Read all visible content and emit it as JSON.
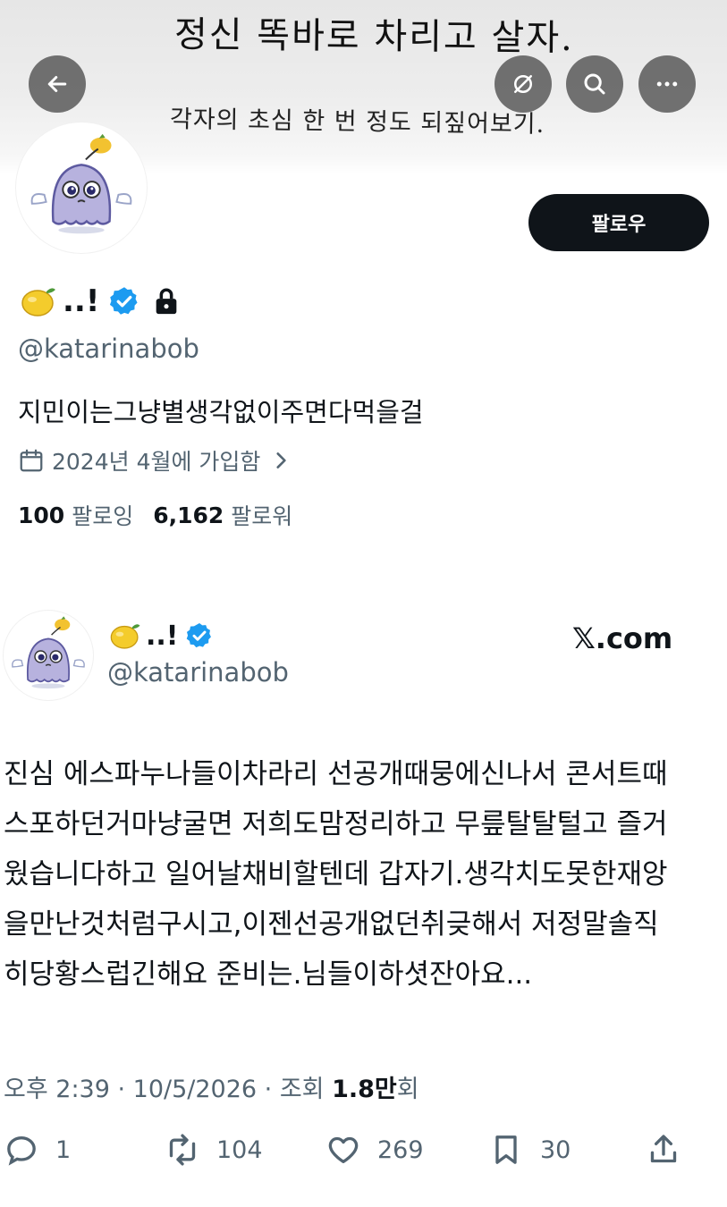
{
  "banner": {
    "line1": "정신 똑바로 차리고 살자.",
    "line2": "각자의 초심 한 번 정도 되짚어보기."
  },
  "header": {
    "back_icon": "arrow-left-icon",
    "grok_icon": "slash-circle-icon",
    "search_icon": "search-icon",
    "more_icon": "more-dots-icon"
  },
  "profile": {
    "avatar_icon": "ghost-mascot-avatar",
    "follow_label": "팔로우",
    "name": "..!",
    "name_emoji": "lemon-emoji",
    "verified_icon": "verified-badge-icon",
    "lock_icon": "lock-icon",
    "handle": "@katarinabob",
    "bio": "지민이는그냥별생각없이주면다먹을걸",
    "joined": "2024년 4월에 가입함",
    "following_count": "100",
    "following_label": "팔로잉",
    "followers_count": "6,162",
    "followers_label": "팔로워"
  },
  "tweet": {
    "name": "..!",
    "handle": "@katarinabob",
    "site": "𝕏.com",
    "body": "진심 에스파누나들이차라리 선공개때뭉에신나서 콘서트때스포하던거마냥굴면 저희도맘정리하고 무릎탈탈털고 즐거웠습니다하고 일어날채비할텐데 갑자기.생각치도못한재앙을만난것처럼구시고,이젠선공개없던취긎해서 저정말솔직히당황스럽긴해요 준비는.님들이하셧잔아요...",
    "time": "오후 2:39 · 10/5/2026 · 조회 ",
    "views": "1.8만",
    "views_suffix": "회",
    "replies": "1",
    "retweets": "104",
    "likes": "269",
    "bookmarks": "30",
    "colors": {
      "text": "#0f1419",
      "secondary": "#536471",
      "verified": "#1d9bf0"
    }
  }
}
